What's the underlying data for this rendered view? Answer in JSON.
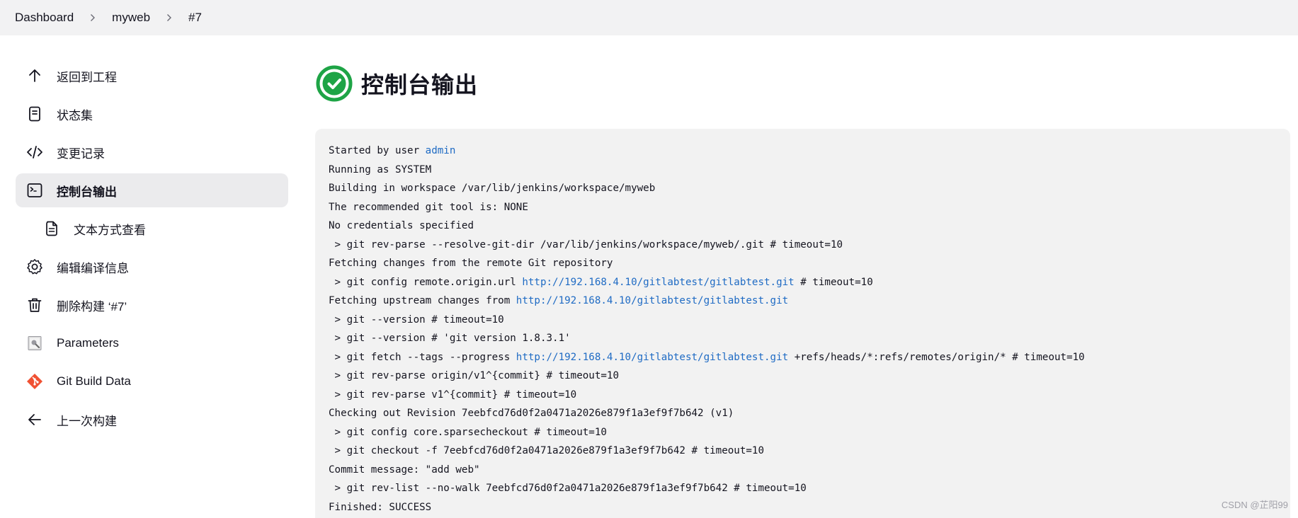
{
  "breadcrumb": {
    "items": [
      "Dashboard",
      "myweb",
      "#7"
    ]
  },
  "sidebar": {
    "items": [
      {
        "label": "返回到工程",
        "icon": "arrow-up-icon"
      },
      {
        "label": "状态集",
        "icon": "document-icon"
      },
      {
        "label": "变更记录",
        "icon": "code-icon"
      },
      {
        "label": "控制台输出",
        "icon": "terminal-icon",
        "active": true
      },
      {
        "label": "文本方式查看",
        "icon": "text-file-icon",
        "sub": true
      },
      {
        "label": "编辑编译信息",
        "icon": "gear-icon"
      },
      {
        "label": "删除构建 ‘#7’",
        "icon": "trash-icon"
      },
      {
        "label": "Parameters",
        "icon": "parameters-icon"
      },
      {
        "label": "Git Build Data",
        "icon": "git-icon"
      },
      {
        "label": "上一次构建",
        "icon": "arrow-left-icon"
      }
    ]
  },
  "main": {
    "title": "控制台输出",
    "status": "success",
    "status_color": "#1ea446"
  },
  "console": {
    "user": "admin",
    "repo_url": "http://192.168.4.10/gitlabtest/gitlabtest.git",
    "lines": {
      "l1_prefix": "Started by user ",
      "l2": "Running as SYSTEM",
      "l3": "Building in workspace /var/lib/jenkins/workspace/myweb",
      "l4": "The recommended git tool is: NONE",
      "l5": "No credentials specified",
      "l6": " > git rev-parse --resolve-git-dir /var/lib/jenkins/workspace/myweb/.git # timeout=10",
      "l7": "Fetching changes from the remote Git repository",
      "l8_prefix": " > git config remote.origin.url ",
      "l8_suffix": " # timeout=10",
      "l9_prefix": "Fetching upstream changes from ",
      "l10": " > git --version # timeout=10",
      "l11": " > git --version # 'git version 1.8.3.1'",
      "l12_prefix": " > git fetch --tags --progress ",
      "l12_suffix": " +refs/heads/*:refs/remotes/origin/* # timeout=10",
      "l13": " > git rev-parse origin/v1^{commit} # timeout=10",
      "l14": " > git rev-parse v1^{commit} # timeout=10",
      "l15": "Checking out Revision 7eebfcd76d0f2a0471a2026e879f1a3ef9f7b642 (v1)",
      "l16": " > git config core.sparsecheckout # timeout=10",
      "l17": " > git checkout -f 7eebfcd76d0f2a0471a2026e879f1a3ef9f7b642 # timeout=10",
      "l18": "Commit message: \"add web\"",
      "l19": " > git rev-list --no-walk 7eebfcd76d0f2a0471a2026e879f1a3ef9f7b642 # timeout=10",
      "l20": "Finished: SUCCESS"
    }
  },
  "watermark": "CSDN @芷阳99",
  "colors": {
    "link": "#1f6bc4",
    "topbar_bg": "#f2f2f3",
    "console_bg": "#f2f2f2",
    "active_bg": "#ebebed"
  }
}
